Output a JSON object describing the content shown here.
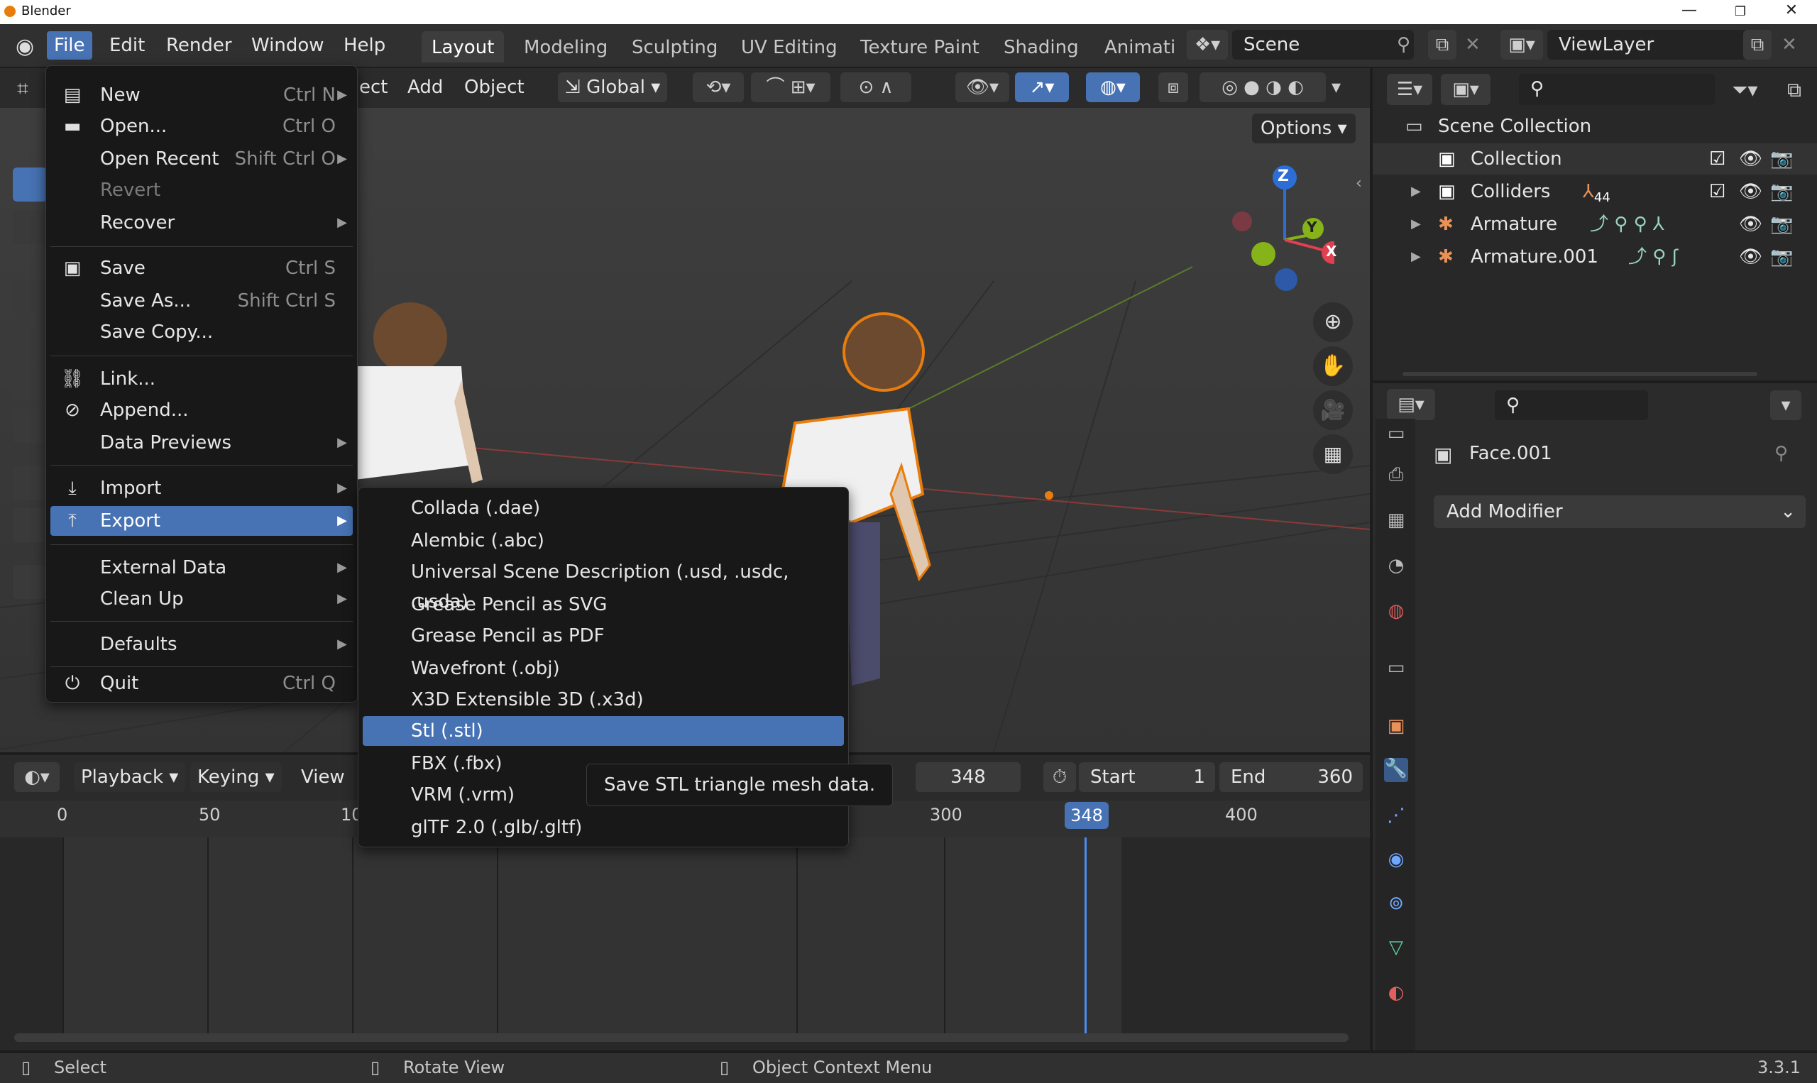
{
  "window": {
    "title": "Blender",
    "min": "—",
    "max": "❐",
    "close": "✕"
  },
  "topbar": {
    "menus": [
      "File",
      "Edit",
      "Render",
      "Window",
      "Help"
    ],
    "workspaces": [
      "Layout",
      "Modeling",
      "Sculpting",
      "UV Editing",
      "Texture Paint",
      "Shading",
      "Animati"
    ],
    "scene": "Scene",
    "view_layer": "ViewLayer"
  },
  "viewport": {
    "menus": [
      "ect",
      "Add",
      "Object"
    ],
    "orientation": "Global",
    "options": "Options",
    "gizmo": {
      "z": "Z",
      "y": "Y",
      "x": "X"
    }
  },
  "file_menu": {
    "items": [
      {
        "label": "New",
        "shortcut": "Ctrl N",
        "submenu": true,
        "icon": "new-file-icon"
      },
      {
        "label": "Open...",
        "shortcut": "Ctrl O",
        "icon": "folder-icon"
      },
      {
        "label": "Open Recent",
        "shortcut": "Shift Ctrl O",
        "submenu": true
      },
      {
        "label": "Revert",
        "disabled": true
      },
      {
        "label": "Recover",
        "submenu": true
      },
      {
        "label": "Save",
        "shortcut": "Ctrl S",
        "icon": "save-icon"
      },
      {
        "label": "Save As...",
        "shortcut": "Shift Ctrl S"
      },
      {
        "label": "Save Copy..."
      },
      {
        "label": "Link...",
        "icon": "link-icon"
      },
      {
        "label": "Append...",
        "icon": "append-icon"
      },
      {
        "label": "Data Previews",
        "submenu": true
      },
      {
        "label": "Import",
        "submenu": true,
        "icon": "import-icon"
      },
      {
        "label": "Export",
        "submenu": true,
        "icon": "export-icon",
        "highlighted": true
      },
      {
        "label": "External Data",
        "submenu": true
      },
      {
        "label": "Clean Up",
        "submenu": true
      },
      {
        "label": "Defaults",
        "submenu": true
      },
      {
        "label": "Quit",
        "shortcut": "Ctrl Q",
        "icon": "power-icon"
      }
    ]
  },
  "export_menu": {
    "items": [
      "Collada (.dae)",
      "Alembic (.abc)",
      "Universal Scene Description (.usd, .usdc, .usda)",
      "Grease Pencil as SVG",
      "Grease Pencil as PDF",
      "Wavefront (.obj)",
      "X3D Extensible 3D (.x3d)",
      "Stl (.stl)",
      "FBX (.fbx)",
      "VRM (.vrm)",
      "glTF 2.0 (.glb/.gltf)"
    ],
    "highlighted": "Stl (.stl)",
    "tooltip": "Save STL triangle mesh data."
  },
  "outliner": {
    "root": "Scene Collection",
    "rows": [
      {
        "label": "Collection"
      },
      {
        "label": "Colliders",
        "badge": "44"
      },
      {
        "label": "Armature"
      },
      {
        "label": "Armature.001"
      }
    ]
  },
  "properties": {
    "object_name": "Face.001",
    "add_modifier": "Add Modifier"
  },
  "timeline": {
    "menus": [
      "Playback",
      "Keying",
      "View"
    ],
    "current_frame": "348",
    "start_label": "Start",
    "start": "1",
    "end_label": "End",
    "end": "360",
    "ticks": [
      "0",
      "50",
      "10",
      "300",
      "348",
      "400"
    ]
  },
  "statusbar": {
    "hints": [
      "Select",
      "Rotate View",
      "Object Context Menu"
    ],
    "version": "3.3.1"
  },
  "colors": {
    "accent": "#4772b3",
    "selection_orange": "#e87d0d",
    "x_axis": "#e0404f",
    "y_axis": "#86b319",
    "z_axis": "#2c6dd6"
  }
}
